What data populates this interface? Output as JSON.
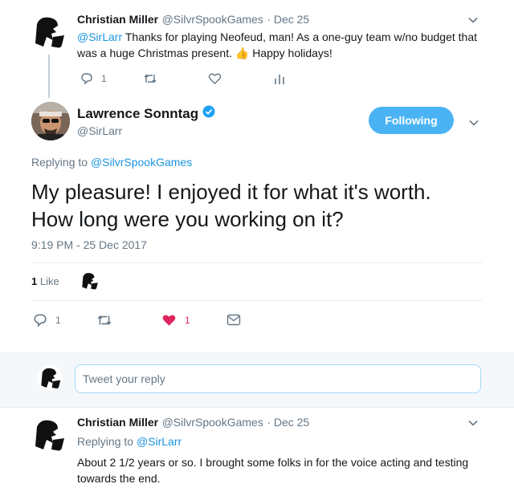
{
  "parent_tweet": {
    "author_name": "Christian Miller",
    "author_handle": "@SilvrSpookGames",
    "date": "· Dec 25",
    "mention": "@SirLarr",
    "text": " Thanks for playing Neofeud, man! As a one-guy team w/no budget that was a huge Christmas present. 👍 Happy holidays!",
    "reply_count": "1",
    "icons": [
      "reply-icon",
      "retweet-icon",
      "like-icon",
      "analytics-icon",
      "chevron-down-icon"
    ]
  },
  "main_tweet": {
    "author_name": "Lawrence Sonntag",
    "verified": true,
    "author_handle": "@SirLarr",
    "follow_label": "Following",
    "replying_to_label": "Replying to",
    "replying_to_handle": "@SilvrSpookGames",
    "text_line1": "My pleasure! I enjoyed it for what it's worth.",
    "text_line2": "How long were you working on it?",
    "timestamp": "9:19 PM - 25 Dec 2017",
    "likes_count": "1",
    "likes_label": "Like",
    "reply_count": "1",
    "like_count": "1",
    "colors": {
      "like_active": "#e0245e",
      "accent": "#1b95e0",
      "follow_bg": "#4ab3f4"
    }
  },
  "reply_box": {
    "placeholder": "Tweet your reply"
  },
  "reply_tweet": {
    "author_name": "Christian Miller",
    "author_handle": "@SilvrSpookGames",
    "date": "· Dec 25",
    "replying_to_label": "Replying to",
    "replying_to_handle": "@SirLarr",
    "text": "About 2 1/2 years or so. I brought some folks in for the voice acting and testing towards the end."
  }
}
